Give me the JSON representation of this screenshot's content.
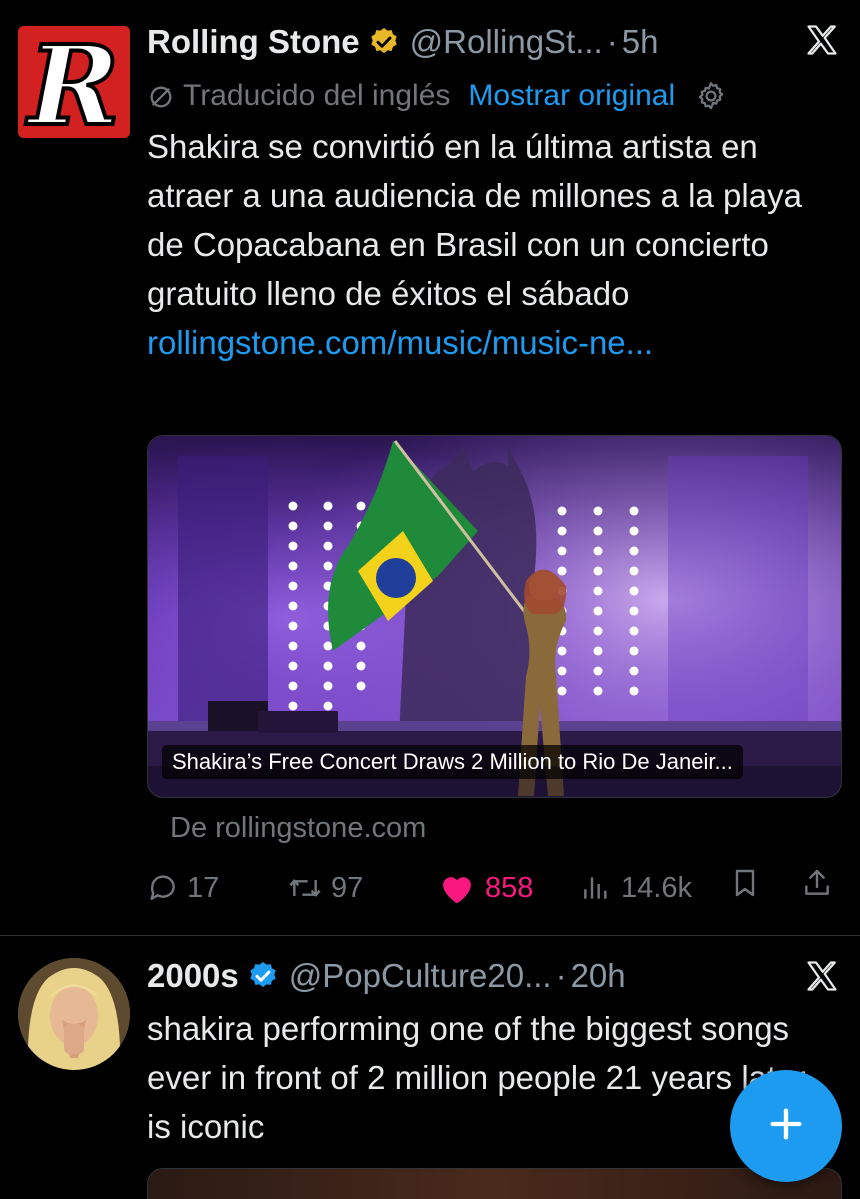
{
  "tweets": [
    {
      "author_name": "Rolling Stone",
      "handle": "@RollingSt...",
      "separator": "·",
      "time": "5h",
      "translation_note": "Traducido del inglés",
      "show_original_label": "Mostrar original",
      "text": "Shakira se convirtió en la última artista en atraer a una audiencia de millones a la playa de Copacabana en Brasil con un concierto gratuito lleno de éxitos el sábado ",
      "link_text": "rollingstone.com/music/music-ne...",
      "card": {
        "caption": "Shakira’s Free Concert Draws 2 Million to Rio De Janeir...",
        "source": "De rollingstone.com"
      },
      "stats": {
        "replies": "17",
        "reposts": "97",
        "likes": "858",
        "views": "14.6k"
      },
      "verified_badge": "gold-verified-icon",
      "liked": true
    },
    {
      "author_name": "2000s",
      "handle": "@PopCulture20...",
      "separator": "·",
      "time": "20h",
      "text": "shakira performing one of the biggest songs ever in front of 2 million people 21 years later is iconic",
      "verified_badge": "blue-verified-icon"
    }
  ],
  "colors": {
    "background": "#000000",
    "text": "#e7e9ea",
    "secondary": "#71767b",
    "link": "#1d9bf0",
    "like": "#f91880",
    "gold_badge": "#e8b829",
    "blue_badge": "#1d9bf0"
  },
  "icons": [
    "x-logo-icon",
    "verified-icon",
    "slash-translate-icon",
    "gear-icon",
    "reply-icon",
    "repost-icon",
    "heart-icon",
    "views-icon",
    "bookmark-icon",
    "share-icon",
    "plus-icon"
  ]
}
